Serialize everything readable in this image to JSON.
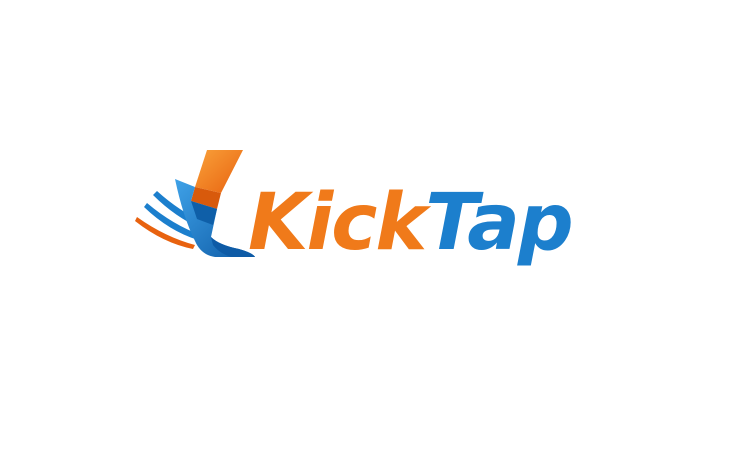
{
  "logo": {
    "wordmark_part1": "Kick",
    "wordmark_part2": "Tap",
    "icon": "running-leg-icon"
  },
  "colors": {
    "orange": "#f07a1a",
    "blue": "#1c7fcd",
    "dark_blue": "#0f5fa8",
    "background": "#ffffff"
  }
}
